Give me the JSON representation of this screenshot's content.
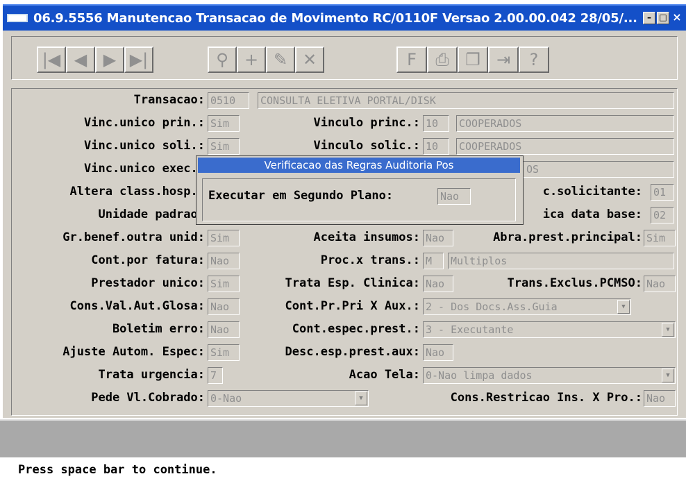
{
  "window": {
    "title": "06.9.5556 Manutencao  Transacao de Movimento RC/0110F Versao 2.00.00.042 28/05/...",
    "min_label": "–",
    "max_label": "□",
    "close_label": "×"
  },
  "toolbar": {
    "buttons": [
      {
        "icon": "first-record-icon",
        "glyph": "|◀"
      },
      {
        "icon": "previous-record-icon",
        "glyph": "◀"
      },
      {
        "icon": "next-record-icon",
        "glyph": "▶"
      },
      {
        "icon": "last-record-icon",
        "glyph": "▶|"
      },
      {
        "icon": "goto-icon",
        "glyph": "⚲"
      },
      {
        "icon": "add-icon",
        "glyph": "+"
      },
      {
        "icon": "modify-icon",
        "glyph": "✎"
      },
      {
        "icon": "delete-icon",
        "glyph": "✕"
      },
      {
        "icon": "filter-icon",
        "glyph": "F"
      },
      {
        "icon": "print-icon",
        "glyph": "⎙"
      },
      {
        "icon": "copy-icon",
        "glyph": "❐"
      },
      {
        "icon": "exit-icon",
        "glyph": "⇥"
      },
      {
        "icon": "help-icon",
        "glyph": "?"
      }
    ]
  },
  "form": {
    "transacao": {
      "label": "Transacao:",
      "code": "0510",
      "desc": "CONSULTA ELETIVA PORTAL/DISK"
    },
    "vinc_unico_prin": {
      "label": "Vinc.unico prin.:",
      "value": "Sim"
    },
    "vinculo_princ": {
      "label": "Vinculo princ.:",
      "code": "10",
      "desc": "COOPERADOS"
    },
    "vinc_unico_soli": {
      "label": "Vinc.unico soli.:",
      "value": "Sim"
    },
    "vinculo_solic": {
      "label": "Vinculo solic.:",
      "code": "10",
      "desc": "COOPERADOS"
    },
    "vinc_unico_exec": {
      "label": "Vinc.unico exec.:",
      "desc_tail": "OS"
    },
    "altera_class_hosp": {
      "label": "Altera class.hosp.:"
    },
    "c_solicitante": {
      "label": "c.solicitante:",
      "value": "01"
    },
    "unidade_padrao": {
      "label": "Unidade padrao:"
    },
    "ica_data_base": {
      "label": "ica data base:",
      "value": "02"
    },
    "gr_benef_outra_unid": {
      "label": "Gr.benef.outra unid:",
      "value": "Sim"
    },
    "aceita_insumos": {
      "label": "Aceita insumos:",
      "value": "Nao"
    },
    "abra_prest_principal": {
      "label": "Abra.prest.principal:",
      "value": "Sim"
    },
    "cont_por_fatura": {
      "label": "Cont.por fatura:",
      "value": "Nao"
    },
    "proc_x_trans": {
      "label": "Proc.x trans.:",
      "code": "M",
      "desc": "Multiplos"
    },
    "prestador_unico": {
      "label": "Prestador unico:",
      "value": "Sim"
    },
    "trata_esp_clinica": {
      "label": "Trata Esp. Clinica:",
      "value": "Nao"
    },
    "trans_exclus_pcmso": {
      "label": "Trans.Exclus.PCMSO:",
      "value": "Nao"
    },
    "cons_val_aut_glosa": {
      "label": "Cons.Val.Aut.Glosa:",
      "value": "Nao"
    },
    "cont_pr_pri_x_aux": {
      "label": "Cont.Pr.Pri X Aux.:",
      "value": "2 - Dos Docs.Ass.Guia"
    },
    "boletim_erro": {
      "label": "Boletim erro:",
      "value": "Nao"
    },
    "cont_espec_prest": {
      "label": "Cont.espec.prest.:",
      "value": "3 - Executante"
    },
    "ajuste_autom_espec": {
      "label": "Ajuste Autom. Espec:",
      "value": "Sim"
    },
    "desc_esp_prest_aux": {
      "label": "Desc.esp.prest.aux:",
      "value": "Nao"
    },
    "trata_urgencia": {
      "label": "Trata urgencia:",
      "value": "7"
    },
    "acao_tela": {
      "label": "Acao Tela:",
      "value": "0-Nao limpa dados"
    },
    "pede_vl_cobrado": {
      "label": "Pede Vl.Cobrado:",
      "value": "0-Nao"
    },
    "cons_restricao_ins_x_pro": {
      "label": "Cons.Restricao Ins. X Pro.:",
      "value": "Nao"
    }
  },
  "dialog": {
    "title": "Verificacao das Regras Auditoria Pos",
    "label": "Executar em Segundo Plano:",
    "value": "Nao"
  },
  "status": {
    "message": "Press space bar to continue."
  }
}
